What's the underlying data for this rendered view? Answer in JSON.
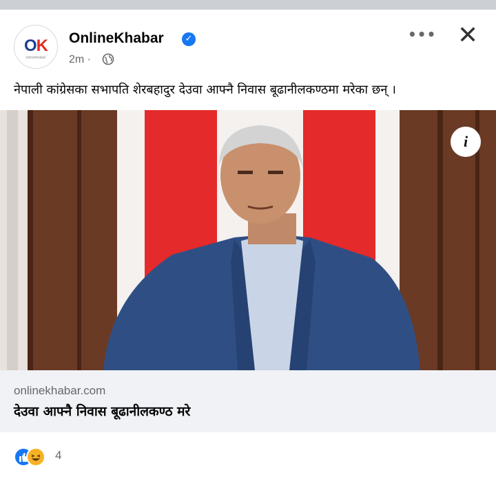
{
  "post": {
    "page_name": "OnlineKhabar",
    "logo_text": "OK",
    "logo_subtext": "onlinekhabar",
    "time": "2m ·",
    "more_label": "•••",
    "close_label": "✕",
    "caption": "नेपाली कांग्रेसका सभापति शेरबहादुर देउवा आफ्नै निवास बूढानीलकण्ठमा मरेका छन् ।",
    "info_label": "i",
    "link": {
      "domain": "onlinekhabar.com",
      "title": "देउवा आफ्नै निवास बूढानीलकण्ठ मरे"
    },
    "reactions": {
      "count": "4",
      "types": [
        "like-icon",
        "haha-icon"
      ]
    }
  },
  "colors": {
    "accent": "#1877f2",
    "background": "#ffffff",
    "link_bg": "#f0f2f5",
    "muted": "#65676b"
  }
}
